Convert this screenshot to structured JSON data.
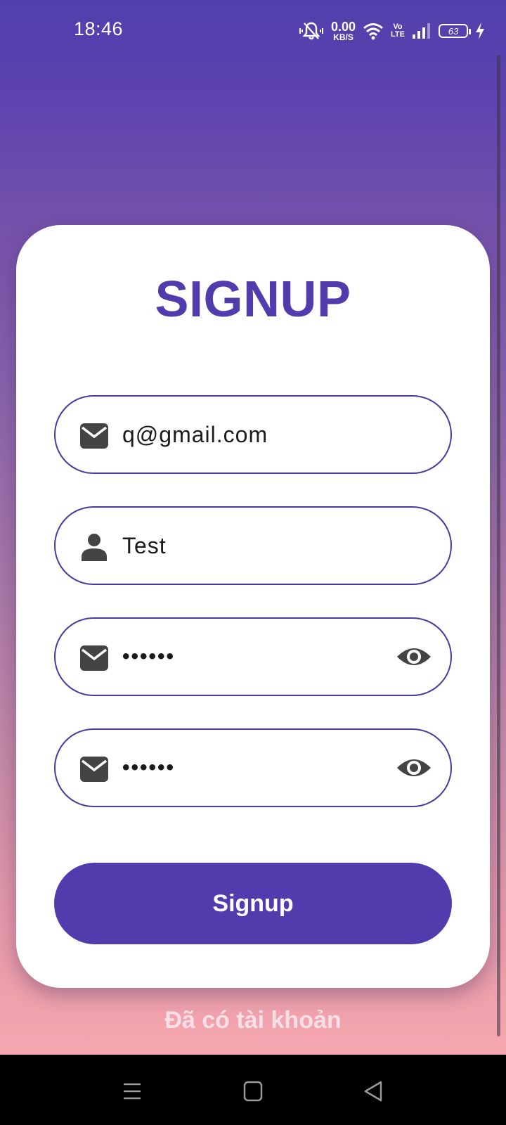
{
  "status_bar": {
    "time": "18:46",
    "net_speed_value": "0.00",
    "net_speed_unit": "KB/S",
    "volte_top": "Vo",
    "volte_bottom": "LTE",
    "battery_level": "63",
    "icons": [
      "mute-icon",
      "wifi-icon",
      "volte-icon",
      "signal-icon",
      "battery-icon",
      "charging-icon"
    ]
  },
  "form": {
    "title": "SIGNUP",
    "fields": [
      {
        "icon": "mail-icon",
        "value": "q@gmail.com"
      },
      {
        "icon": "person-icon",
        "value": "Test"
      },
      {
        "icon": "mail-icon",
        "value": "••••••",
        "trailing_icon": "eye-icon"
      },
      {
        "icon": "mail-icon",
        "value": "••••••",
        "trailing_icon": "eye-icon"
      }
    ],
    "submit_label": "Signup",
    "login_link": "Đã có tài khoản"
  },
  "colors": {
    "accent": "#523BAD",
    "card": "#FFFFFF",
    "icon": "#444444",
    "gradient_top": "#523FAD",
    "gradient_bottom": "#F5A6AE"
  },
  "nav_bar": {
    "icons": [
      "menu-icon",
      "home-icon",
      "back-icon"
    ]
  }
}
